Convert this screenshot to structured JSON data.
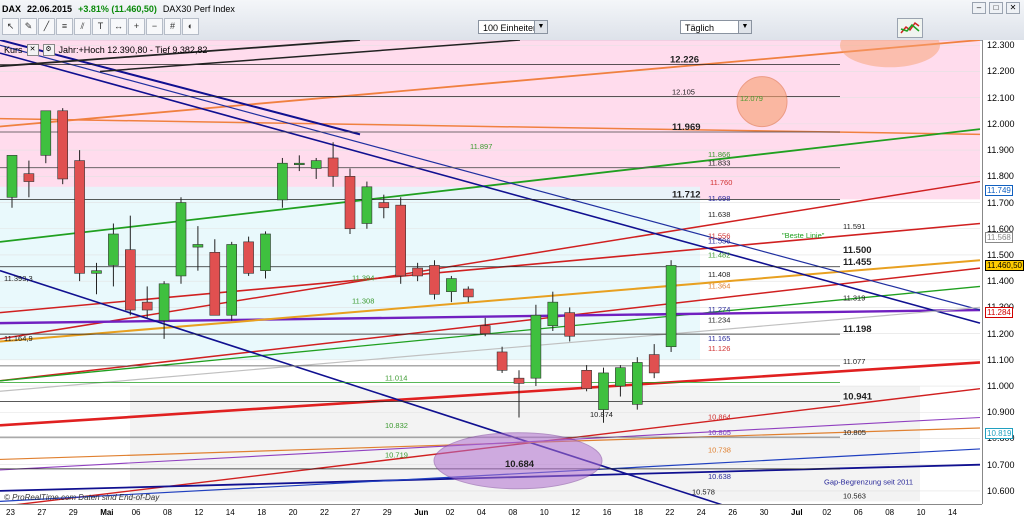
{
  "window": {
    "instrument": "DAX",
    "date": "22.06.2015",
    "change": "+3.81% (11.460,50)",
    "series_name": "DAX30 Perf Index",
    "units_select": "100 Einheiten",
    "interval_select": "Täglich",
    "close_glyph": "✕",
    "min_glyph": "–",
    "max_glyph": "□"
  },
  "toolbar_icons": [
    "cursor-icon",
    "pencil-icon",
    "line-icon",
    "fib-icon",
    "channel-icon",
    "text-icon",
    "measure-icon",
    "zoom-in-icon",
    "zoom-out-icon",
    "grid-icon",
    "color-icon"
  ],
  "header": {
    "label": "Kurs",
    "info": "Jahr:+Hoch 12.390,80 - Tief 9.382,82"
  },
  "footer": "© ProRealTime.com  Daten sind End-of-Day",
  "chart_data": {
    "type": "candlestick",
    "y_range": [
      10550,
      12320
    ],
    "y_ticks": [
      "12.300",
      "12.200",
      "12.100",
      "12.000",
      "11.900",
      "11.800",
      "11.700",
      "11.600",
      "11.500",
      "11.400",
      "11.300",
      "11.200",
      "11.100",
      "11.000",
      "10.900",
      "10.800",
      "10.700",
      "10.600"
    ],
    "x_ticks": [
      "23",
      "27",
      "29",
      "Mai",
      "06",
      "08",
      "12",
      "14",
      "18",
      "20",
      "22",
      "27",
      "29",
      "Jun",
      "02",
      "04",
      "08",
      "10",
      "12",
      "16",
      "18",
      "22",
      "24",
      "26",
      "30",
      "Jul",
      "02",
      "06",
      "08",
      "10",
      "14"
    ],
    "candles": [
      {
        "o": 11720,
        "h": 11840,
        "l": 11680,
        "c": 11880
      },
      {
        "o": 11810,
        "h": 11860,
        "l": 11720,
        "c": 11780
      },
      {
        "o": 11880,
        "h": 12040,
        "l": 11850,
        "c": 12050
      },
      {
        "o": 12050,
        "h": 12060,
        "l": 11770,
        "c": 11790
      },
      {
        "o": 11860,
        "h": 11900,
        "l": 11400,
        "c": 11430
      },
      {
        "o": 11430,
        "h": 11470,
        "l": 11350,
        "c": 11440
      },
      {
        "o": 11460,
        "h": 11620,
        "l": 11380,
        "c": 11580
      },
      {
        "o": 11520,
        "h": 11650,
        "l": 11270,
        "c": 11290
      },
      {
        "o": 11320,
        "h": 11380,
        "l": 11260,
        "c": 11290
      },
      {
        "o": 11250,
        "h": 11400,
        "l": 11180,
        "c": 11390
      },
      {
        "o": 11420,
        "h": 11720,
        "l": 11390,
        "c": 11700
      },
      {
        "o": 11530,
        "h": 11610,
        "l": 11440,
        "c": 11540
      },
      {
        "o": 11510,
        "h": 11560,
        "l": 11290,
        "c": 11270
      },
      {
        "o": 11270,
        "h": 11550,
        "l": 11250,
        "c": 11540
      },
      {
        "o": 11550,
        "h": 11570,
        "l": 11420,
        "c": 11430
      },
      {
        "o": 11440,
        "h": 11590,
        "l": 11410,
        "c": 11580
      },
      {
        "o": 11710,
        "h": 11870,
        "l": 11680,
        "c": 11850
      },
      {
        "o": 11845,
        "h": 11880,
        "l": 11820,
        "c": 11850
      },
      {
        "o": 11830,
        "h": 11870,
        "l": 11790,
        "c": 11860
      },
      {
        "o": 11870,
        "h": 11930,
        "l": 11760,
        "c": 11800
      },
      {
        "o": 11800,
        "h": 11830,
        "l": 11580,
        "c": 11600
      },
      {
        "o": 11620,
        "h": 11780,
        "l": 11600,
        "c": 11760
      },
      {
        "o": 11700,
        "h": 11730,
        "l": 11640,
        "c": 11680
      },
      {
        "o": 11690,
        "h": 11720,
        "l": 11390,
        "c": 11420
      },
      {
        "o": 11450,
        "h": 11470,
        "l": 11400,
        "c": 11420
      },
      {
        "o": 11460,
        "h": 11480,
        "l": 11330,
        "c": 11350
      },
      {
        "o": 11360,
        "h": 11420,
        "l": 11320,
        "c": 11410
      },
      {
        "o": 11370,
        "h": 11380,
        "l": 11320,
        "c": 11340
      },
      {
        "o": 11230,
        "h": 11260,
        "l": 11190,
        "c": 11200
      },
      {
        "o": 11130,
        "h": 11150,
        "l": 11050,
        "c": 11060
      },
      {
        "o": 11030,
        "h": 11060,
        "l": 10880,
        "c": 11010
      },
      {
        "o": 11030,
        "h": 11310,
        "l": 11000,
        "c": 11270
      },
      {
        "o": 11230,
        "h": 11360,
        "l": 11210,
        "c": 11320
      },
      {
        "o": 11280,
        "h": 11300,
        "l": 11170,
        "c": 11190
      },
      {
        "o": 11060,
        "h": 11080,
        "l": 10980,
        "c": 10990
      },
      {
        "o": 10910,
        "h": 11070,
        "l": 10860,
        "c": 11050
      },
      {
        "o": 11000,
        "h": 11080,
        "l": 10960,
        "c": 11070
      },
      {
        "o": 10930,
        "h": 11110,
        "l": 10910,
        "c": 11090
      },
      {
        "o": 11120,
        "h": 11160,
        "l": 11030,
        "c": 11050
      },
      {
        "o": 11150,
        "h": 11480,
        "l": 11130,
        "c": 11460
      }
    ],
    "level_labels": [
      {
        "v": 12226,
        "t": "12.226",
        "bold": true
      },
      {
        "v": 12105,
        "t": "12.105"
      },
      {
        "v": 12079,
        "t": "12.079",
        "color": "#4a9a30"
      },
      {
        "v": 11969,
        "t": "11.969",
        "bold": true
      },
      {
        "v": 11897,
        "t": "11.897",
        "color": "#3c9a30"
      },
      {
        "v": 11866,
        "t": "11.866",
        "color": "#3c9a30"
      },
      {
        "v": 11833,
        "t": "11.833"
      },
      {
        "v": 11760,
        "t": "11.760",
        "color": "#d03030"
      },
      {
        "v": 11712,
        "t": "11.712",
        "bold": true
      },
      {
        "v": 11698,
        "t": "11.698",
        "color": "#2a2a9a"
      },
      {
        "v": 11638,
        "t": "11.638"
      },
      {
        "v": 11591,
        "t": "11.591"
      },
      {
        "v": 11556,
        "t": "11.556",
        "color": "#d03030"
      },
      {
        "v": 11536,
        "t": "11.536",
        "color": "#2a2a9a"
      },
      {
        "v": 11500,
        "t": "11.500",
        "bold": true
      },
      {
        "v": 11482,
        "t": "11.482",
        "color": "#3c9a30"
      },
      {
        "v": 11455,
        "t": "11.455",
        "bold": true
      },
      {
        "v": 11408,
        "t": "11.408"
      },
      {
        "v": 11394,
        "t": "11.394",
        "color": "#3c9a30"
      },
      {
        "v": 11393,
        "t": "11.393,3"
      },
      {
        "v": 11364,
        "t": "11.364",
        "color": "#e08030"
      },
      {
        "v": 11319,
        "t": "11.319"
      },
      {
        "v": 11308,
        "t": "11.308",
        "color": "#3c9a30"
      },
      {
        "v": 11274,
        "t": "11.274",
        "color": "#2a2a9a"
      },
      {
        "v": 11234,
        "t": "11.234"
      },
      {
        "v": 11198,
        "t": "11.198",
        "bold": true
      },
      {
        "v": 11165,
        "t": "11.165",
        "color": "#2a2a9a"
      },
      {
        "v": 11164,
        "t": "11.164,9"
      },
      {
        "v": 11126,
        "t": "11.126",
        "color": "#d03030"
      },
      {
        "v": 11077,
        "t": "11.077"
      },
      {
        "v": 11014,
        "t": "11.014",
        "color": "#3c9a30"
      },
      {
        "v": 10941,
        "t": "10.941",
        "bold": true
      },
      {
        "v": 10874,
        "t": "10.874"
      },
      {
        "v": 10864,
        "t": "10.864",
        "color": "#d03030"
      },
      {
        "v": 10832,
        "t": "10.832",
        "color": "#3c9a30"
      },
      {
        "v": 10805,
        "t": "10.805",
        "color": "#8040c0"
      },
      {
        "v": 10805,
        "t": "10.805"
      },
      {
        "v": 10738,
        "t": "10.738",
        "color": "#e08030"
      },
      {
        "v": 10719,
        "t": "10.719",
        "color": "#3c9a30"
      },
      {
        "v": 10684,
        "t": "10.684",
        "bold": true
      },
      {
        "v": 10638,
        "t": "10.638",
        "color": "#2a2a9a"
      },
      {
        "v": 10578,
        "t": "10.578"
      },
      {
        "v": 10563,
        "t": "10.563"
      }
    ],
    "annotations": [
      "\"Beste Linie\"",
      "Gap-Begrenzung seit 2011"
    ],
    "price_tags": [
      {
        "v": 11749,
        "t": "11.749",
        "color": "#1060c0",
        "bg": "#ffffff"
      },
      {
        "v": 11568,
        "t": "11.568",
        "color": "#888888",
        "bg": "#ffffff"
      },
      {
        "v": 11460.5,
        "t": "11.460,50",
        "color": "#000000",
        "bg": "#ffcc00"
      },
      {
        "v": 11284,
        "t": "11.284",
        "color": "#d00000",
        "bg": "#ffffff"
      },
      {
        "v": 10819,
        "t": "10.819",
        "color": "#20a0c0",
        "bg": "#ffffff"
      }
    ],
    "colors": {
      "up": "#3fc03f",
      "down": "#e05050",
      "wick": "#222222",
      "pink_zone": "#ffd6ea",
      "cyan_zone": "#e4f7fb"
    }
  }
}
